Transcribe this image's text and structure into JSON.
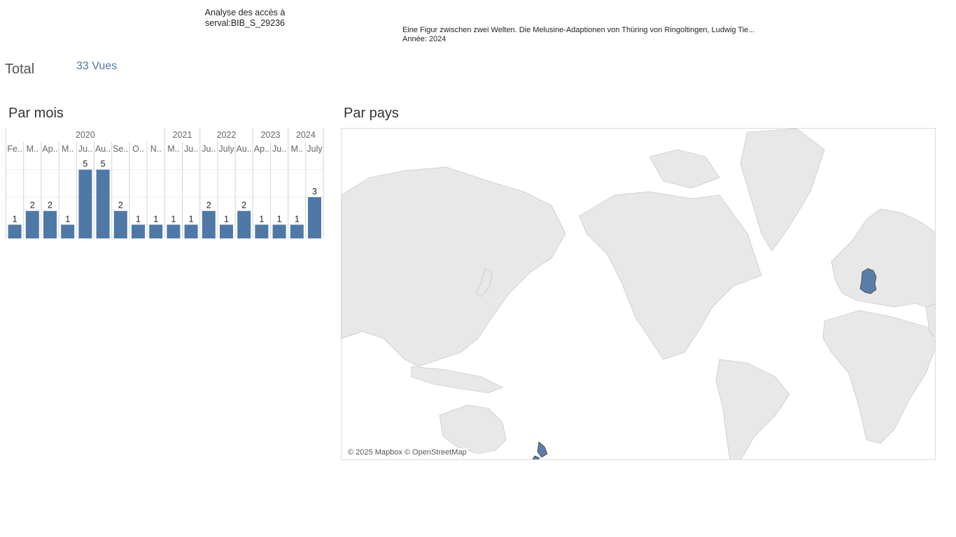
{
  "header": {
    "title": "Analyse des accès à\nserval:BIB_S_29236",
    "doc_title": "Eine Figur zwischen zwei Welten. Die Melusine-Adaptionen von Thüring von Ringoltingen, Ludwig Tie...",
    "doc_year": "Année: 2024"
  },
  "total": {
    "label": "Total",
    "value": "33 Vues"
  },
  "sections": {
    "by_month": "Par mois",
    "by_country": "Par pays"
  },
  "map": {
    "attribution": "© 2025 Mapbox © OpenStreetMap",
    "highlighted_countries": [
      "Germany",
      "New Zealand"
    ],
    "land_color": "#e8e8e8",
    "highlight_color": "#5b7ea6"
  },
  "colors": {
    "bar": "#4e79a7",
    "accent": "#4e79a7"
  },
  "chart_data": {
    "type": "bar",
    "years": [
      {
        "label": "2020",
        "span": 9
      },
      {
        "label": "2021",
        "span": 2
      },
      {
        "label": "2022",
        "span": 3
      },
      {
        "label": "2023",
        "span": 2
      },
      {
        "label": "2024",
        "span": 2
      }
    ],
    "categories": [
      "Fe..",
      "M..",
      "Ap..",
      "M..",
      "Ju..",
      "Au..",
      "Se..",
      "O..",
      "N..",
      "M..",
      "Ju..",
      "Ju..",
      "July",
      "Au..",
      "Ap..",
      "Ju..",
      "M..",
      "July"
    ],
    "values": [
      1,
      2,
      2,
      1,
      5,
      5,
      2,
      1,
      1,
      1,
      1,
      2,
      1,
      2,
      1,
      1,
      1,
      3
    ],
    "data_labels": [
      "1",
      "2",
      "2",
      "1",
      "5",
      "5",
      "2",
      "1",
      "1",
      "1",
      "1",
      "2",
      "1",
      "2",
      "1",
      "1",
      "1",
      "3"
    ],
    "ylim": [
      0,
      6
    ],
    "grid": true
  }
}
